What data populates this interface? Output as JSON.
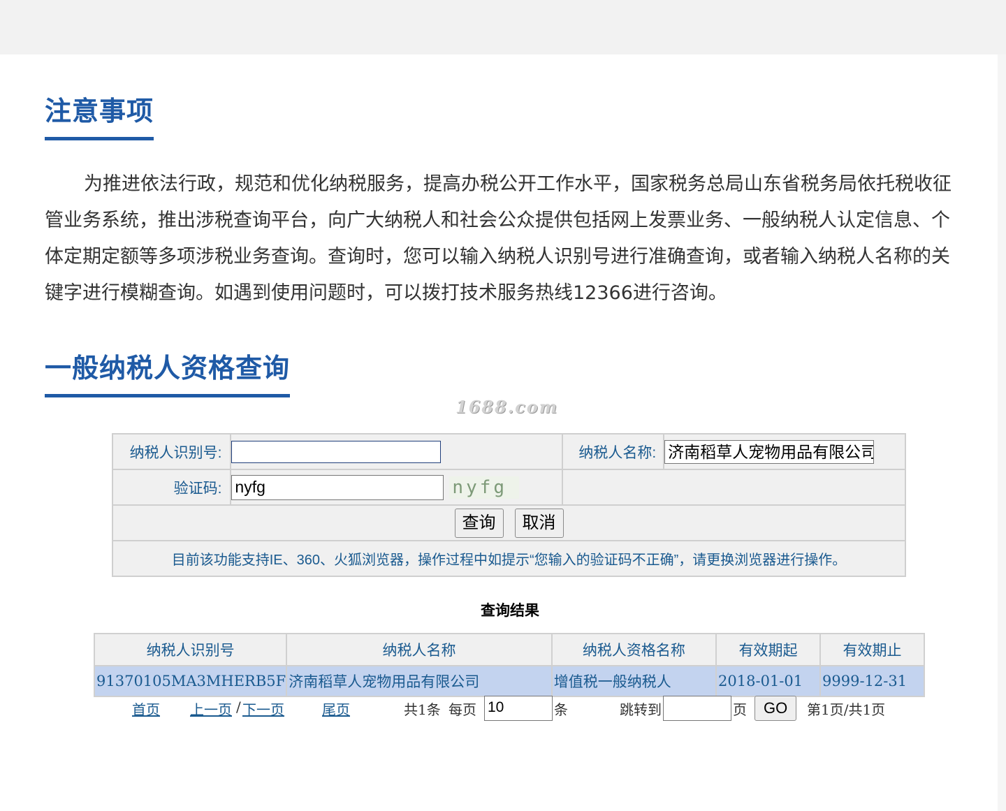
{
  "notice": {
    "title": "注意事项",
    "body": "为推进依法行政，规范和优化纳税服务，提高办税公开工作水平，国家税务总局山东省税务局依托税收征管业务系统，推出涉税查询平台，向广大纳税人和社会公众提供包括网上发票业务、一般纳税人认定信息、个体定期定额等多项涉税业务查询。查询时，您可以输入纳税人识别号进行准确查询，或者输入纳税人名称的关键字进行模糊查询。如遇到使用问题时，可以拨打技术服务热线12366进行咨询。"
  },
  "query": {
    "title": "一般纳税人资格查询",
    "watermark": "1688.com",
    "form": {
      "taxpayer_id_label": "纳税人识别号:",
      "taxpayer_id_value": "",
      "taxpayer_name_label": "纳税人名称:",
      "taxpayer_name_value": "济南稻草人宠物用品有限公司",
      "captcha_label": "验证码:",
      "captcha_value": "nyfg",
      "captcha_image_text": "nyfg",
      "submit_label": "查询",
      "cancel_label": "取消",
      "tip": "目前该功能支持IE、360、火狐浏览器，操作过程中如提示“您输入的验证码不正确”，请更换浏览器进行操作。"
    }
  },
  "results": {
    "title": "查询结果",
    "columns": [
      "纳税人识别号",
      "纳税人名称",
      "纳税人资格名称",
      "有效期起",
      "有效期止"
    ],
    "rows": [
      [
        "91370105MA3MHERB5F",
        "济南稻草人宠物用品有限公司",
        "增值税一般纳税人",
        "2018-01-01",
        "9999-12-31"
      ]
    ]
  },
  "pager": {
    "first": "首页",
    "prev": "上一页",
    "separator": "/",
    "next": "下一页",
    "last": "尾页",
    "total": "共1条",
    "per_page_label": "每页",
    "per_page_value": "10",
    "per_page_unit": "条",
    "jump_label": "跳转到",
    "jump_value": "",
    "page_unit": "页",
    "go_label": "GO",
    "status": "第1页/共1页"
  },
  "colors": {
    "heading_blue": "#1f5aa6",
    "text_blue": "#1a5a8f",
    "result_row_bg": "#c3d3ef"
  }
}
